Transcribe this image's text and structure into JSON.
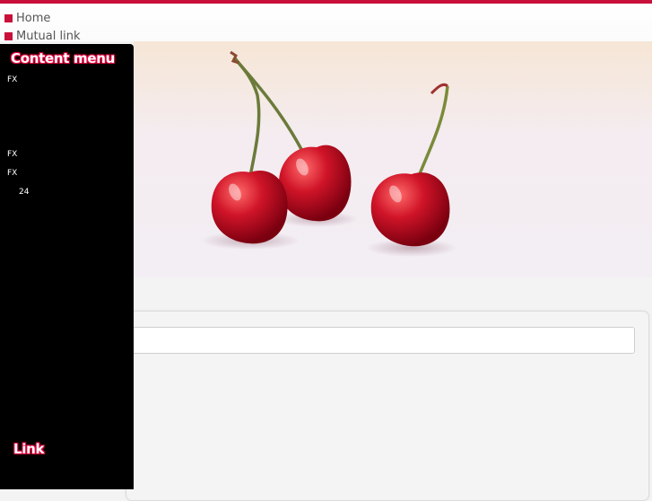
{
  "nav": {
    "home_label": "Home",
    "mutual_link_label": "Mutual link"
  },
  "sidebar": {
    "content_menu_heading": "Content menu",
    "items": [
      {
        "label": "FX"
      },
      {
        "label": "FX"
      },
      {
        "label": "FX"
      },
      {
        "label": "24"
      }
    ],
    "link_heading": "Link"
  },
  "search": {
    "placeholder": ""
  },
  "colors": {
    "accent": "#c8103a",
    "sidebar_bg": "#000000",
    "heading_glow": "#e0003c"
  }
}
